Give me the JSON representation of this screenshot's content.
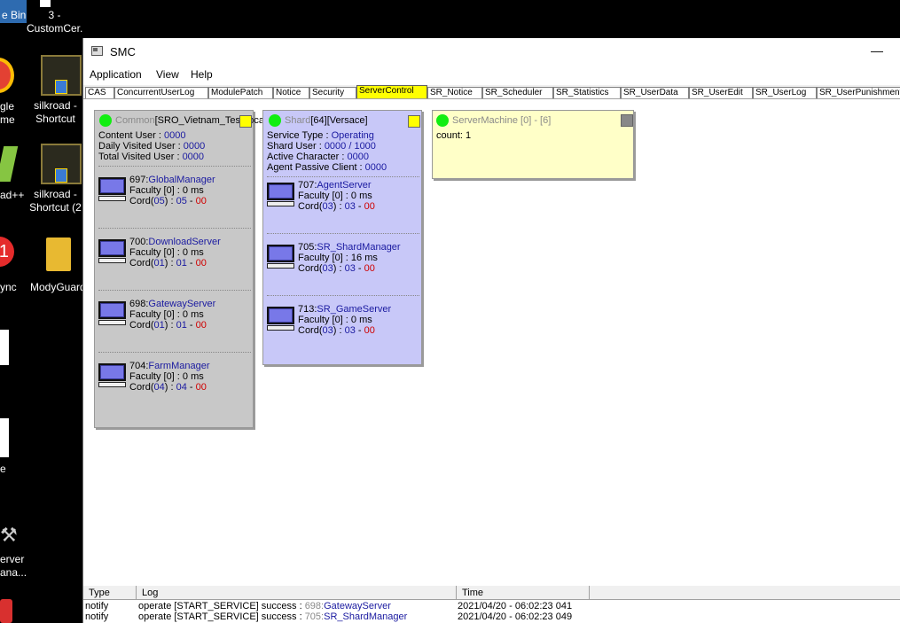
{
  "desktop": {
    "icons": [
      {
        "label": "e Bin",
        "color": "#5b9bd5"
      },
      {
        "label": "3 -",
        "color": ""
      },
      {
        "label": "CustomCer...",
        "color": ""
      },
      {
        "label": "gle",
        "color": "#e34133"
      },
      {
        "label": "me",
        "color": ""
      },
      {
        "label": "silkroad -",
        "color": ""
      },
      {
        "label": "Shortcut",
        "color": ""
      },
      {
        "label": "ad++",
        "color": "#86c542"
      },
      {
        "label": "silkroad -",
        "color": ""
      },
      {
        "label": "Shortcut (2",
        "color": ""
      },
      {
        "label": "ync",
        "color": "#e52b2b"
      },
      {
        "label": "ModyGuard",
        "color": "#e8b931"
      },
      {
        "label": "e",
        "color": ""
      },
      {
        "label": "erver",
        "color": ""
      },
      {
        "label": "ana...",
        "color": ""
      }
    ]
  },
  "window": {
    "title": "SMC",
    "minimize": "—"
  },
  "menu": [
    "Application",
    "View",
    "Help"
  ],
  "tabs": [
    {
      "label": "CAS"
    },
    {
      "label": "ConcurrentUserLog"
    },
    {
      "label": "ModulePatch"
    },
    {
      "label": "Notice"
    },
    {
      "label": "Security"
    },
    {
      "label": "ServerControl"
    },
    {
      "label": "SR_Notice"
    },
    {
      "label": "SR_Scheduler"
    },
    {
      "label": "SR_Statistics"
    },
    {
      "label": "SR_UserData"
    },
    {
      "label": "SR_UserEdit"
    },
    {
      "label": "SR_UserLog"
    },
    {
      "label": "SR_UserPunishment"
    }
  ],
  "active_tab": "ServerControl",
  "common": {
    "h_prefix": "Common",
    "h_name": "[SRO_Vietnam_TestLocal",
    "content_label": "Content User : ",
    "content_val": "0000",
    "daily_label": "Daily Visited User : ",
    "daily_val": "0000",
    "total_label": "Total Visited User : ",
    "total_val": "0000",
    "servers": [
      {
        "id": "697:",
        "name": "GlobalManager",
        "faculty": "Faculty [0] : 0 ms",
        "cord_a": "Cord(",
        "cord_b": "05",
        "cord_c": ") : ",
        "cord_d": "05",
        "cord_e": " - ",
        "cord_f": "00"
      },
      {
        "id": "700:",
        "name": "DownloadServer",
        "faculty": "Faculty [0] : 0 ms",
        "cord_a": "Cord(",
        "cord_b": "01",
        "cord_c": ") : ",
        "cord_d": "01",
        "cord_e": " - ",
        "cord_f": "00"
      },
      {
        "id": "698:",
        "name": "GatewayServer",
        "faculty": "Faculty [0] : 0 ms",
        "cord_a": "Cord(",
        "cord_b": "01",
        "cord_c": ") : ",
        "cord_d": "01",
        "cord_e": " - ",
        "cord_f": "00"
      },
      {
        "id": "704:",
        "name": "FarmManager",
        "faculty": "Faculty [0] : 0 ms",
        "cord_a": "Cord(",
        "cord_b": "04",
        "cord_c": ") : ",
        "cord_d": "04",
        "cord_e": " - ",
        "cord_f": "00"
      }
    ]
  },
  "shard": {
    "h_prefix": "Shard",
    "h_name": "[64][Versace]",
    "service_label": "Service Type : ",
    "service_val": "Operating",
    "shard_label": "Shard User : ",
    "shard_val": "0000 / 1000",
    "active_label": "Active Character : ",
    "active_val": "0000",
    "agent_label": "Agent Passive Client : ",
    "agent_val": "0000",
    "servers": [
      {
        "id": "707:",
        "name": "AgentServer",
        "faculty": "Faculty [0] : 0 ms",
        "cord_a": "Cord(",
        "cord_b": "03",
        "cord_c": ") : ",
        "cord_d": "03",
        "cord_e": " - ",
        "cord_f": "00"
      },
      {
        "id": "705:",
        "name": "SR_ShardManager",
        "faculty": "Faculty [0] : 16 ms",
        "cord_a": "Cord(",
        "cord_b": "03",
        "cord_c": ") : ",
        "cord_d": "03",
        "cord_e": " - ",
        "cord_f": "00"
      },
      {
        "id": "713:",
        "name": "SR_GameServer",
        "faculty": "Faculty [0] : 0 ms",
        "cord_a": "Cord(",
        "cord_b": "03",
        "cord_c": ") : ",
        "cord_d": "03",
        "cord_e": " - ",
        "cord_f": "00"
      }
    ]
  },
  "machine": {
    "h_prefix": "ServerMachine",
    "h_range": " [0] - [6]",
    "count": "count: 1"
  },
  "log": {
    "headers": [
      "Type",
      "Log",
      "Time"
    ],
    "rows": [
      {
        "type": "notify",
        "text": "operate [START_SERVICE] success : ",
        "id": "698:",
        "name": "GatewayServer",
        "time": "2021/04/20 - 06:02:23 041"
      },
      {
        "type": "notify",
        "text": "operate [START_SERVICE] success : ",
        "id": "705:",
        "name": "SR_ShardManager",
        "time": "2021/04/20 - 06:02:23 049"
      }
    ]
  },
  "colors": {
    "common_bg": "#c8c8c8",
    "shard_bg": "#c8c8f8",
    "machine_bg": "#ffffc8",
    "status_on": "#11ee11",
    "flag_yellow": "#ffff00",
    "flag_gray": "#888888",
    "tab_active": "#ffff00"
  }
}
